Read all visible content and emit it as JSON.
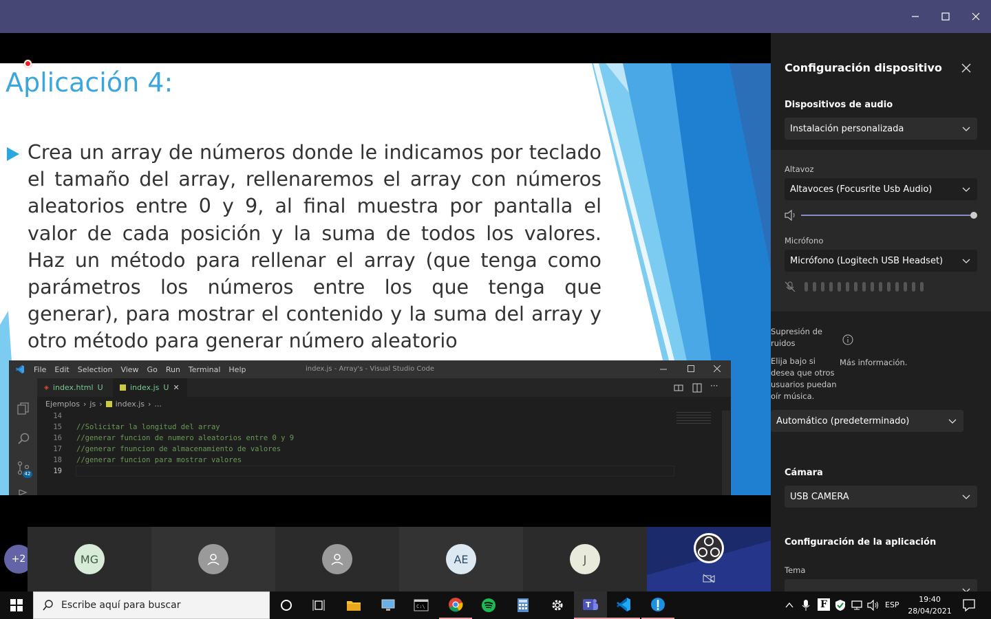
{
  "slide": {
    "title": "Aplicación 4:",
    "body": "Crea un array de números donde le indicamos por teclado el tamaño del array, rellenaremos el array con números aleatorios entre 0 y 9, al final muestra por pantalla el valor de cada posición y la suma de todos los valores. Haz un método para rellenar el array (que tenga como parámetros los números entre los que tenga que generar), para mostrar el contenido y la suma del array y otro método  para generar número aleatorio"
  },
  "vscode": {
    "menu": [
      "File",
      "Edit",
      "Selection",
      "View",
      "Go",
      "Run",
      "Terminal",
      "Help"
    ],
    "window_title": "index.js - Array's - Visual Studio Code",
    "tabs": [
      {
        "name": "index.html",
        "status": "U"
      },
      {
        "name": "index.js",
        "status": "U",
        "close": "✕"
      }
    ],
    "breadcrumb": [
      "Ejemplos",
      "js",
      "index.js",
      "..."
    ],
    "source_control_badge": "42",
    "lines": [
      {
        "n": "14",
        "text": ""
      },
      {
        "n": "15",
        "text": "//Solicitar la longitud del array"
      },
      {
        "n": "16",
        "text": "//generar funcion de numero aleatorios entre 0 y 9"
      },
      {
        "n": "17",
        "text": "//generar fnuncion de almacenamiento de valores"
      },
      {
        "n": "18",
        "text": "//generar funcion para mostrar valores"
      },
      {
        "n": "19",
        "text": ""
      }
    ]
  },
  "panel": {
    "title": "Configuración dispositivo",
    "audio_devices_label": "Dispositivos de audio",
    "audio_devices_value": "Instalación personalizada",
    "speaker_label": "Altavoz",
    "speaker_value": "Altavoces (Focusrite Usb Audio)",
    "speaker_volume": 1.0,
    "mic_label": "Micrófono",
    "mic_value": "Micrófono (Logitech USB Headset)",
    "noise_label": "Supresión de ruidos",
    "noise_desc": "Elija bajo si desea que otros usuarios puedan oír música.",
    "more_info": "Más información.",
    "noise_value": "Automático (predeterminado)",
    "camera_label": "Cámara",
    "camera_value": "USB CAMERA",
    "app_config_label": "Configuración de la aplicación",
    "theme_label": "Tema"
  },
  "participants": {
    "more": "+2",
    "tiles": [
      "MG",
      "",
      "",
      "AE",
      "J"
    ]
  },
  "taskbar": {
    "search_placeholder": "Escribe aquí para buscar",
    "lang": "ESP",
    "time": "19:40",
    "date": "28/04/2021"
  },
  "colors": {
    "teams_purple": "#464775",
    "accent_blue": "#29a8e0",
    "taskbar": "#101010"
  }
}
